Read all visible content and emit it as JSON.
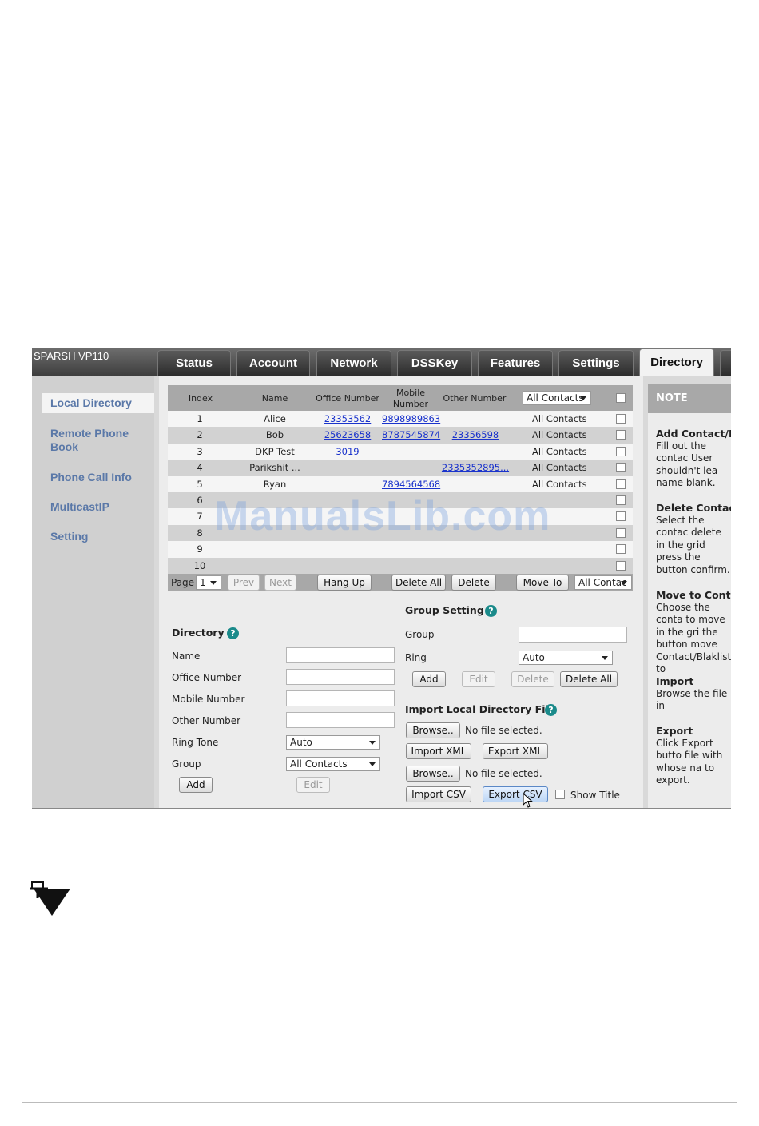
{
  "brand": "SPARSH VP110",
  "tabs": [
    "Status",
    "Account",
    "Network",
    "DSSKey",
    "Features",
    "Settings",
    "Directory"
  ],
  "active_tab": "Directory",
  "sidebar": {
    "items": [
      "Local Directory",
      "Remote Phone Book",
      "Phone Call Info",
      "MulticastIP",
      "Setting"
    ]
  },
  "grid": {
    "headers": {
      "index": "Index",
      "name": "Name",
      "office": "Office Number",
      "mobile": "Mobile Number",
      "other": "Other Number"
    },
    "filter": "All Contacts",
    "rows": [
      {
        "index": "1",
        "name": "Alice",
        "office": "23353562",
        "mobile": "9898989863",
        "other": "",
        "group": "All Contacts"
      },
      {
        "index": "2",
        "name": "Bob",
        "office": "25623658",
        "mobile": "8787545874",
        "other": "23356598",
        "group": "All Contacts"
      },
      {
        "index": "3",
        "name": "DKP Test",
        "office": "3019",
        "mobile": "",
        "other": "",
        "group": "All Contacts"
      },
      {
        "index": "4",
        "name": "Parikshit ...",
        "office": "",
        "mobile": "",
        "other": "2335352895...",
        "group": "All Contacts"
      },
      {
        "index": "5",
        "name": "Ryan",
        "office": "",
        "mobile": "7894564568",
        "other": "",
        "group": "All Contacts"
      },
      {
        "index": "6",
        "name": "",
        "office": "",
        "mobile": "",
        "other": "",
        "group": ""
      },
      {
        "index": "7",
        "name": "",
        "office": "",
        "mobile": "",
        "other": "",
        "group": ""
      },
      {
        "index": "8",
        "name": "",
        "office": "",
        "mobile": "",
        "other": "",
        "group": ""
      },
      {
        "index": "9",
        "name": "",
        "office": "",
        "mobile": "",
        "other": "",
        "group": ""
      },
      {
        "index": "10",
        "name": "",
        "office": "",
        "mobile": "",
        "other": "",
        "group": ""
      }
    ],
    "pager": {
      "page_label": "Page",
      "page_value": "1",
      "prev": "Prev",
      "next": "Next",
      "hang_up": "Hang Up",
      "delete_all": "Delete All",
      "delete": "Delete",
      "move_to": "Move To",
      "move_target": "All Contac"
    }
  },
  "directory_form": {
    "title": "Directory",
    "labels": {
      "name": "Name",
      "office": "Office Number",
      "mobile": "Mobile Number",
      "other": "Other Number",
      "ring_tone": "Ring Tone",
      "group": "Group"
    },
    "ring_tone_value": "Auto",
    "group_value": "All Contacts",
    "add": "Add",
    "edit": "Edit"
  },
  "group_setting": {
    "title": "Group Setting",
    "group_label": "Group",
    "ring_label": "Ring",
    "ring_value": "Auto",
    "add": "Add",
    "edit": "Edit",
    "delete": "Delete",
    "delete_all": "Delete All"
  },
  "import": {
    "title": "Import Local Directory File",
    "browse": "Browse..",
    "no_file": "No file selected.",
    "import_xml": "Import XML",
    "export_xml": "Export XML",
    "import_csv": "Import CSV",
    "export_csv": "Export CSV",
    "show_title": "Show Title"
  },
  "note": {
    "title": "NOTE",
    "sections": [
      {
        "title": "Add Contact/Bl",
        "text": "Fill out the contac User shouldn't lea name blank."
      },
      {
        "title": "Delete Contact/",
        "text": "Select the contac delete in the grid press the button confirm."
      },
      {
        "title": "Move to Contac",
        "text": "Choose the conta to move in the gri the button move Contact/Blaklist to"
      },
      {
        "title": "Import",
        "text": "Browse the file in"
      },
      {
        "title": "Export",
        "text": "Click Export butto file with whose na to export."
      }
    ]
  },
  "watermark": "ManualsLib.com"
}
